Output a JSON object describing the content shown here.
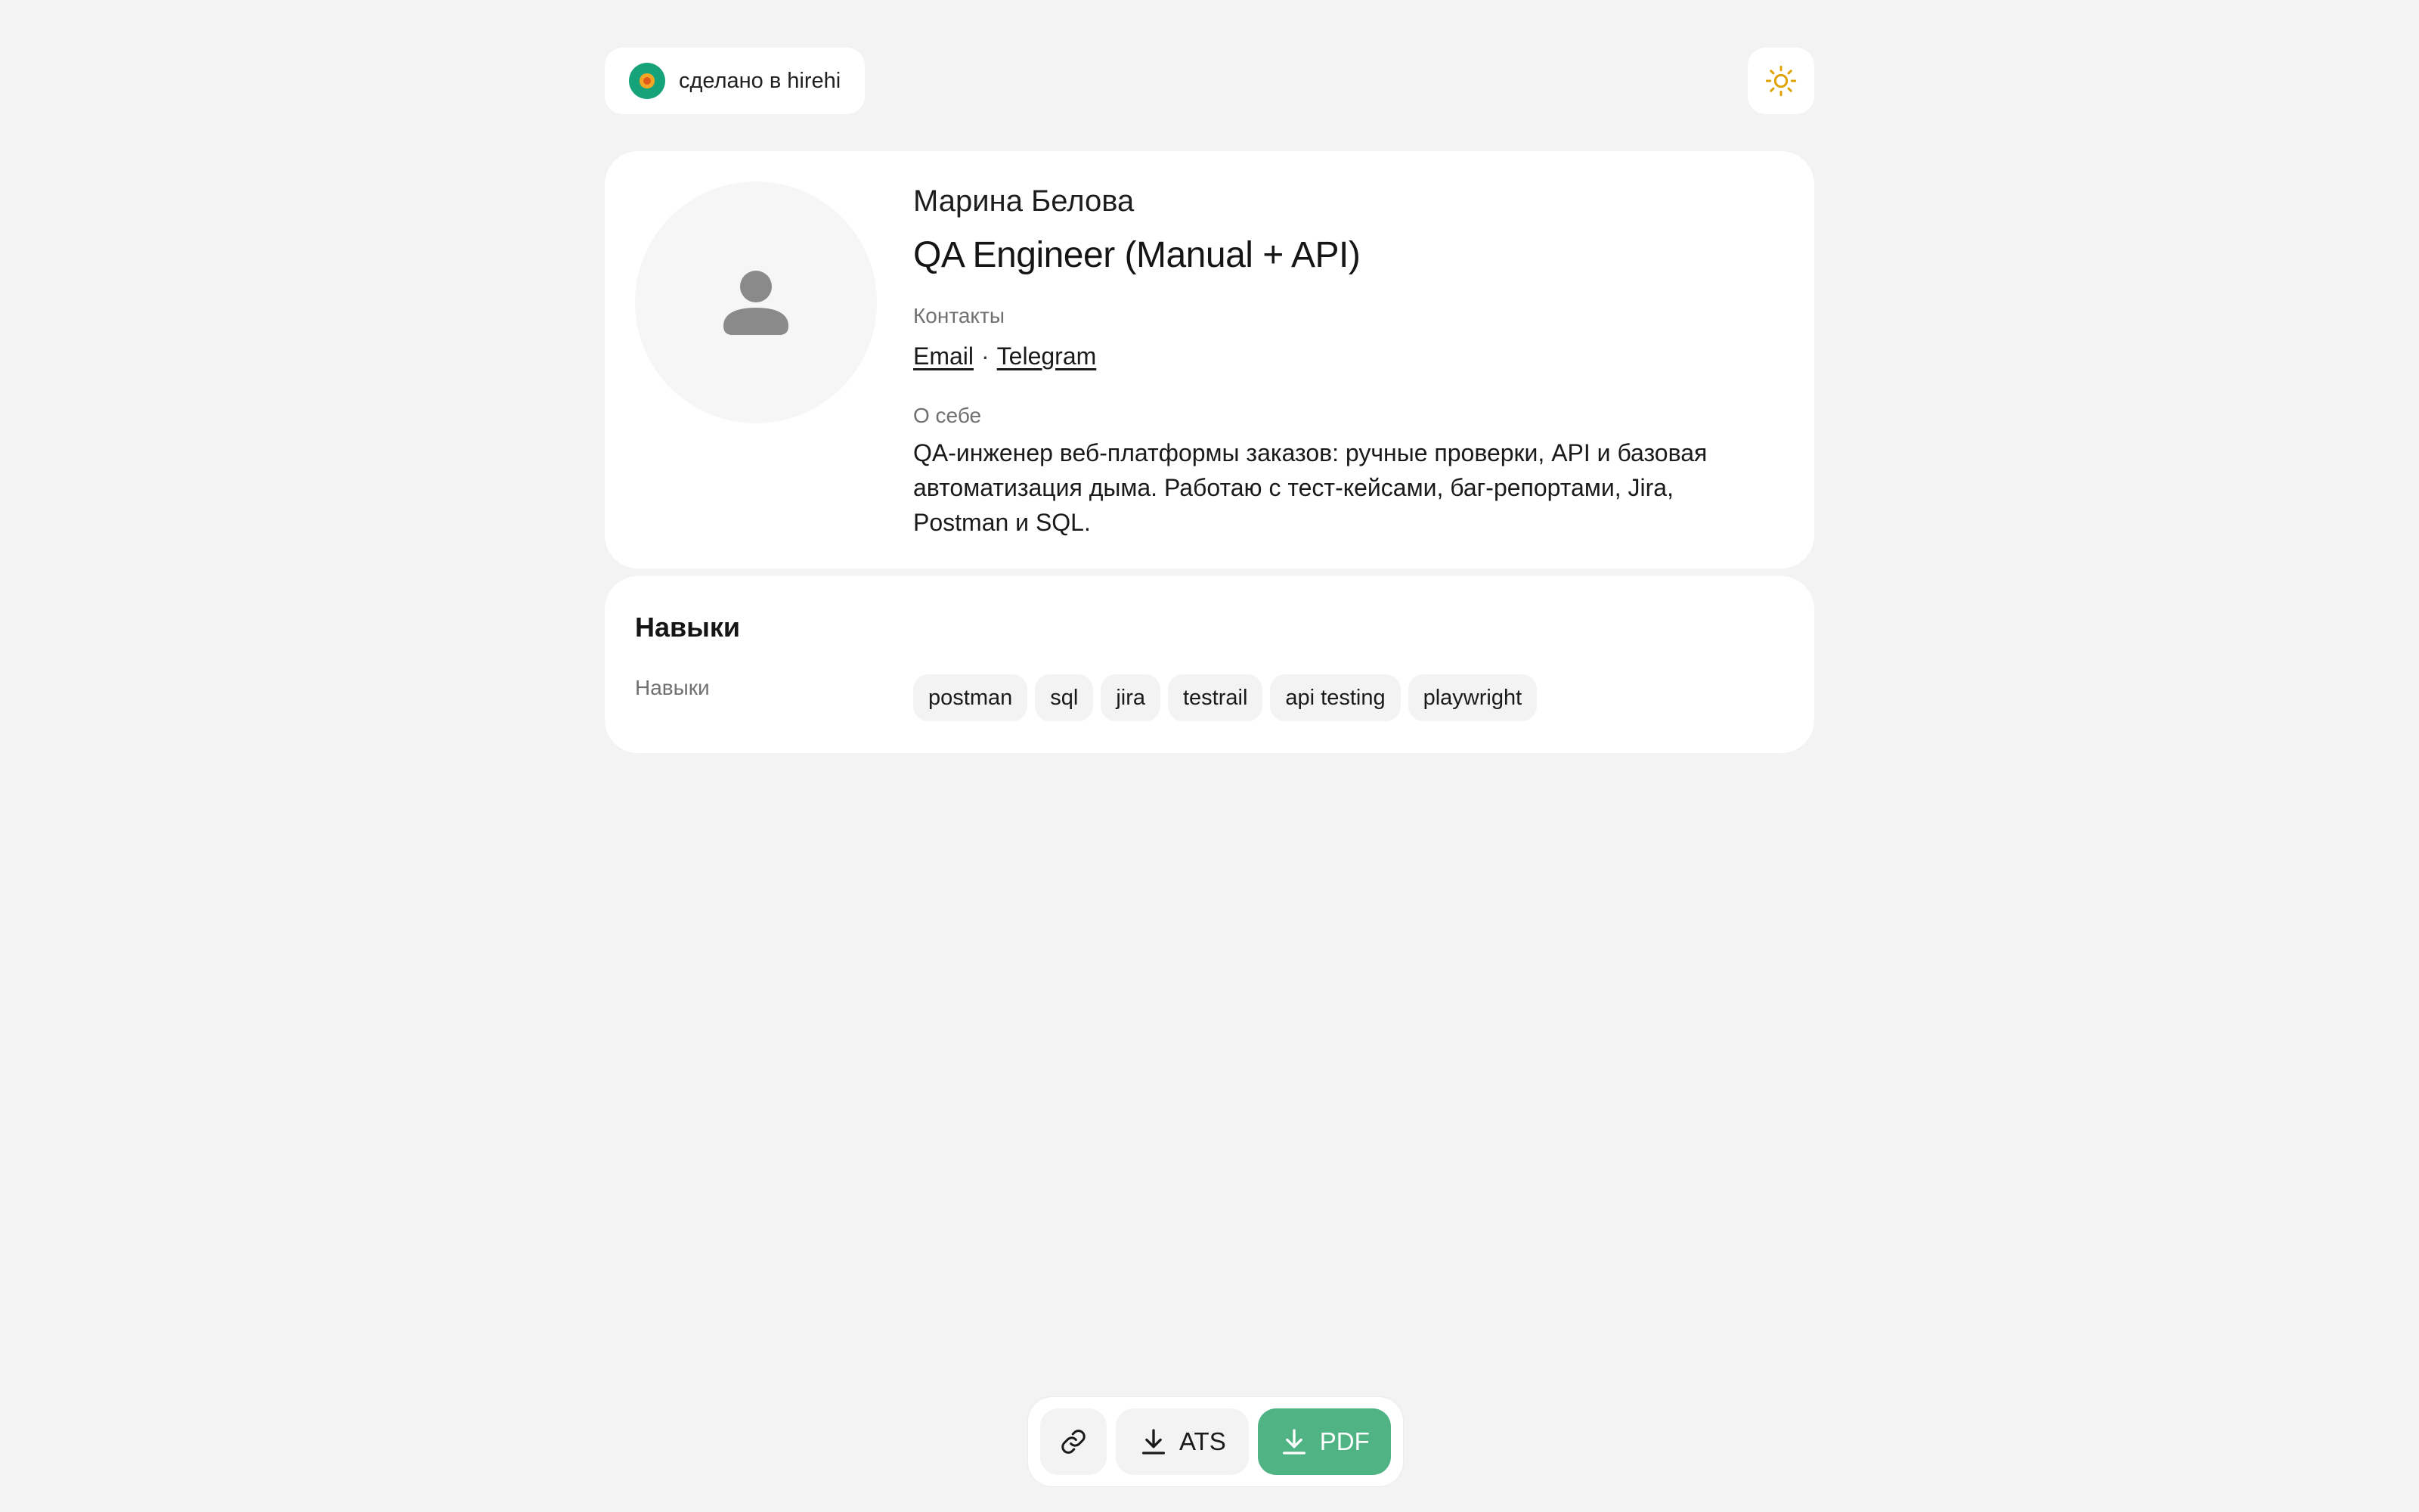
{
  "header": {
    "made_in_text": "сделано в hirehi",
    "theme_icon": "sun-icon",
    "accent_color": "#17a37a"
  },
  "profile": {
    "avatar_icon": "person-icon",
    "name": "Марина Белова",
    "position": "QA Engineer (Manual + API)",
    "contacts_label": "Контакты",
    "contacts": [
      {
        "label": "Email"
      },
      {
        "label": "Telegram"
      }
    ],
    "separator": "·",
    "about_label": "О себе",
    "about_text": "QA-инженер веб-платформы заказов: ручные проверки, API и базовая автоматизация дыма. Работаю с тест-кейсами, баг-репортами, Jira, Postman и SQL."
  },
  "skills": {
    "title": "Навыки",
    "label": "Навыки",
    "items": [
      "postman",
      "sql",
      "jira",
      "testrail",
      "api testing",
      "playwright"
    ]
  },
  "toolbar": {
    "link_icon": "link-icon",
    "ats_label": "ATS",
    "pdf_label": "PDF",
    "pdf_color": "#4fb384"
  }
}
